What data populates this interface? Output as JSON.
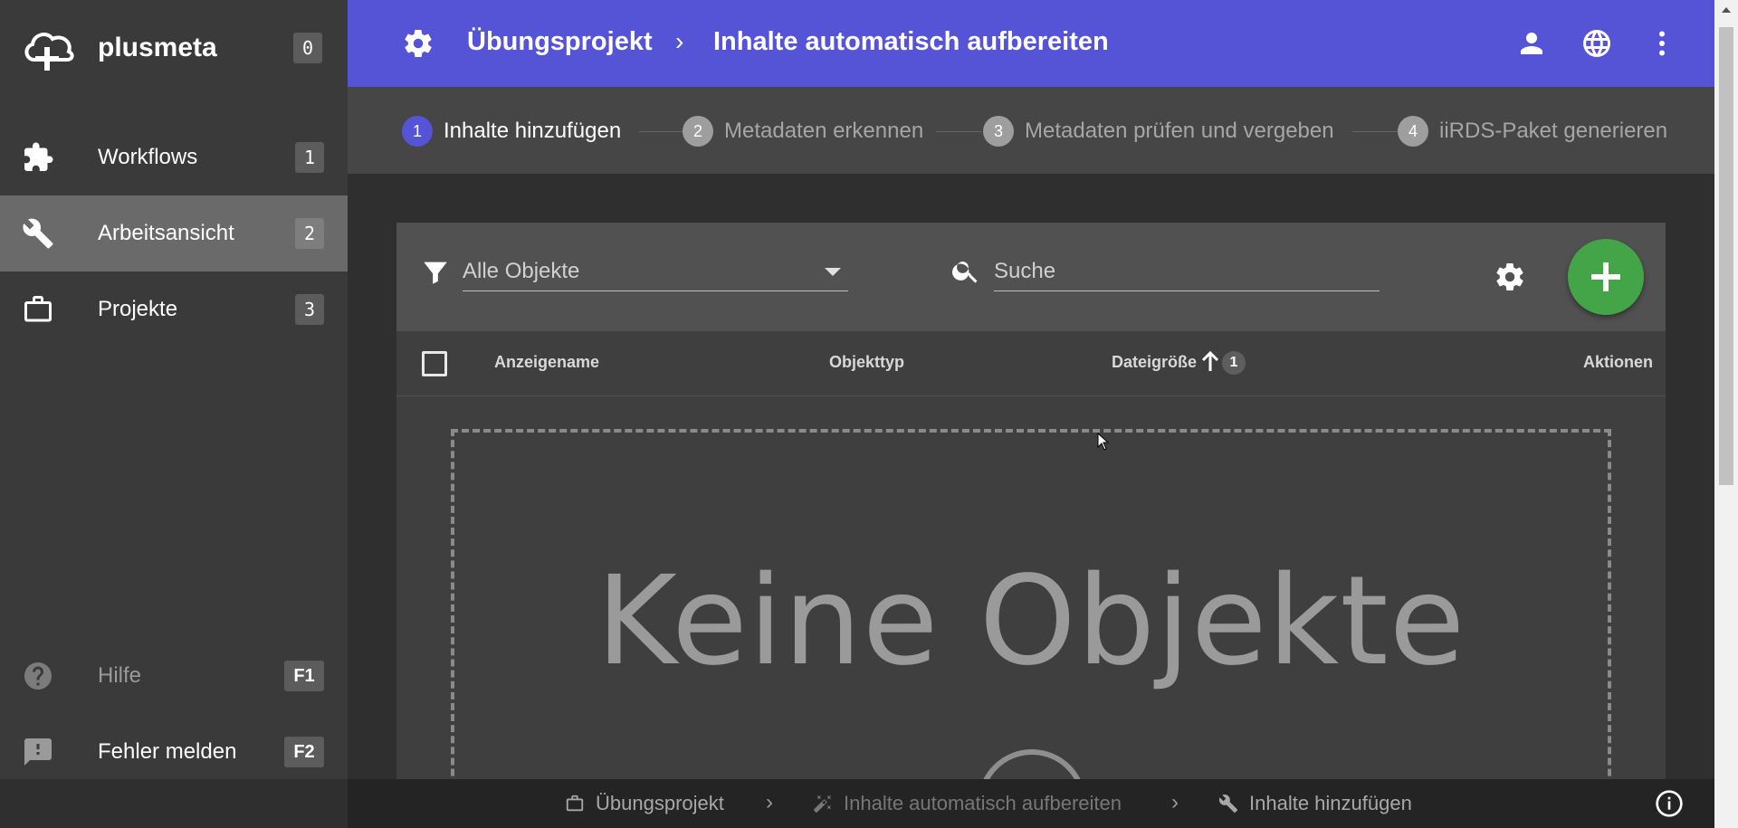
{
  "app": {
    "name": "plusmeta",
    "name_shortcut": "0"
  },
  "sidebar": {
    "items": [
      {
        "label": "Workflows",
        "shortcut": "1",
        "icon": "puzzle-icon",
        "active": false
      },
      {
        "label": "Arbeitsansicht",
        "shortcut": "2",
        "icon": "wrench-icon",
        "active": true
      },
      {
        "label": "Projekte",
        "shortcut": "3",
        "icon": "briefcase-icon",
        "active": false
      }
    ],
    "footer": [
      {
        "label": "Hilfe",
        "shortcut": "F1",
        "icon": "help-icon"
      },
      {
        "label": "Fehler melden",
        "shortcut": "F2",
        "icon": "feedback-icon"
      }
    ]
  },
  "header": {
    "project": "Übungsprojekt",
    "separator": "›",
    "workflow": "Inhalte automatisch aufbereiten",
    "accent_color": "#5553d6"
  },
  "stepper": {
    "steps": [
      {
        "number": "1",
        "label": "Inhalte hinzufügen",
        "active": true
      },
      {
        "number": "2",
        "label": "Metadaten erkennen",
        "active": false
      },
      {
        "number": "3",
        "label": "Metadaten prüfen und vergeben",
        "active": false
      },
      {
        "number": "4",
        "label": "iiRDS-Paket generieren",
        "active": false
      }
    ]
  },
  "toolbar": {
    "filter_value": "Alle Objekte",
    "search_placeholder": "Suche",
    "add_button_color": "#43a548"
  },
  "table": {
    "columns": [
      "Anzeigename",
      "Objekttyp",
      "Dateigröße",
      "Aktionen"
    ],
    "sort_badge": "1",
    "empty_text": "Keine Objekte"
  },
  "footer_breadcrumb": {
    "items": [
      {
        "label": "Übungsprojekt",
        "icon": "briefcase-icon"
      },
      {
        "label": "Inhalte automatisch aufbereiten",
        "icon": "magic-wand-icon"
      },
      {
        "label": "Inhalte hinzufügen",
        "icon": "wrench-icon"
      }
    ]
  }
}
